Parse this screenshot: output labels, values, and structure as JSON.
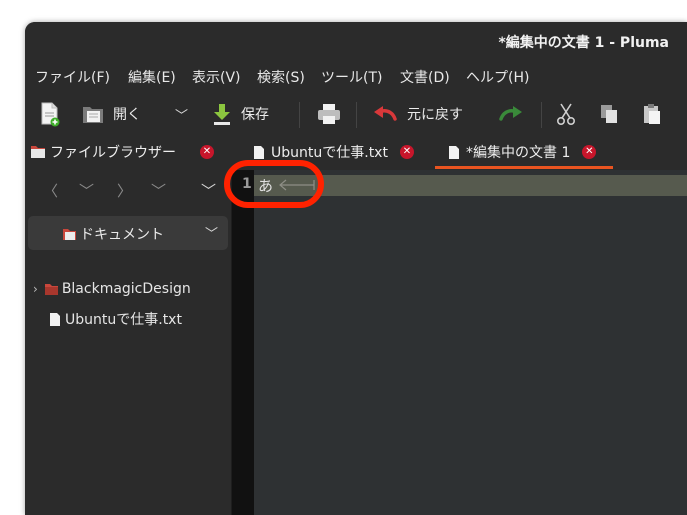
{
  "window": {
    "title": "*編集中の文書 1 - Pluma"
  },
  "menubar": {
    "items": [
      {
        "label": "ファイル(F)"
      },
      {
        "label": "編集(E)"
      },
      {
        "label": "表示(V)"
      },
      {
        "label": "検索(S)"
      },
      {
        "label": "ツール(T)"
      },
      {
        "label": "文書(D)"
      },
      {
        "label": "ヘルプ(H)"
      }
    ]
  },
  "toolbar": {
    "open_label": "開く",
    "save_label": "保存",
    "undo_label": "元に戻す"
  },
  "sidebar": {
    "tab_label": "ファイルブラウザー",
    "location": "ドキュメント",
    "tree": [
      {
        "label": "BlackmagicDesign",
        "type": "folder"
      },
      {
        "label": "Ubuntuで仕事.txt",
        "type": "file"
      }
    ]
  },
  "tabs": [
    {
      "label": "Ubuntuで仕事.txt",
      "active": false
    },
    {
      "label": "*編集中の文書 1",
      "active": true
    }
  ],
  "editor": {
    "line_number": "1",
    "text": "あ"
  },
  "colors": {
    "accent": "#e95420",
    "close": "#c7162b",
    "highlight": "#ff2200"
  }
}
